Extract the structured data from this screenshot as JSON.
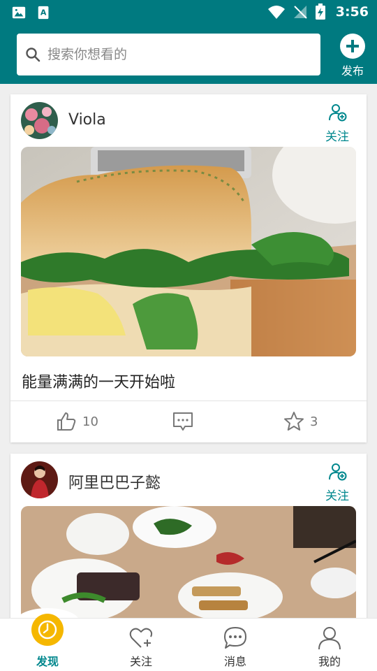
{
  "status_bar": {
    "time": "3:56"
  },
  "search": {
    "placeholder": "搜索你想看的"
  },
  "publish": {
    "label": "发布"
  },
  "posts": [
    {
      "user": "Viola",
      "follow_label": "关注",
      "caption": "能量满满的一天开始啦",
      "likes": "10",
      "stars": "3"
    },
    {
      "user": "阿里巴巴子懿",
      "follow_label": "关注"
    }
  ],
  "nav": {
    "items": [
      {
        "label": "发现",
        "active": true
      },
      {
        "label": "关注"
      },
      {
        "label": "消息"
      },
      {
        "label": "我的"
      }
    ]
  },
  "colors": {
    "header": "#007a80",
    "accent": "#00878d",
    "discover": "#f5b700"
  }
}
